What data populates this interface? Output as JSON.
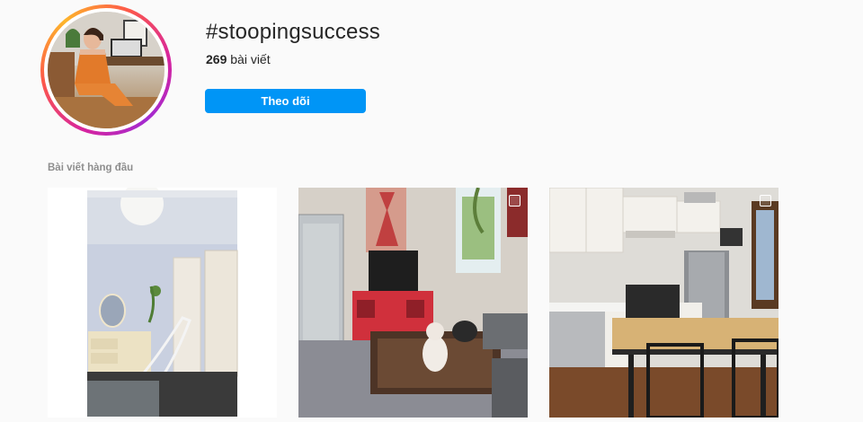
{
  "header": {
    "hashtag": "#stoopingsuccess",
    "post_count": "269",
    "post_count_suffix": " bài viết",
    "follow_label": "Theo dõi"
  },
  "section": {
    "top_posts_label": "Bài viết hàng đầu"
  },
  "posts": [
    {
      "id": "post-1",
      "icon": "none"
    },
    {
      "id": "post-2",
      "icon": "multiple-images-icon"
    },
    {
      "id": "post-3",
      "icon": "multiple-images-icon"
    }
  ],
  "colors": {
    "background": "#fafafa",
    "follow_button": "#0095f6",
    "secondary_text": "#8e8e8e"
  }
}
